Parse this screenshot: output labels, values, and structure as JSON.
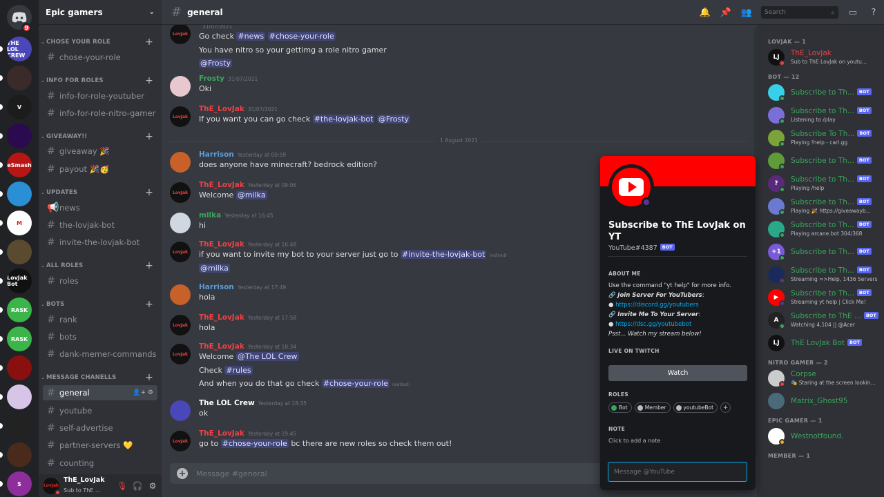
{
  "server": {
    "name": "Epic gamers",
    "home_badge": "9"
  },
  "rail": [
    {
      "label": "THE LOL CREW",
      "color": "#4a47b8"
    },
    {
      "label": "",
      "color": "#3b2a2a"
    },
    {
      "label": "V",
      "color": "#1c1c1c"
    },
    {
      "label": "",
      "color": "#2b0a4f"
    },
    {
      "label": "TheSmashen",
      "color": "#b81515"
    },
    {
      "label": "",
      "color": "#2a8fd4"
    },
    {
      "label": "M",
      "color": "#ffffff"
    },
    {
      "label": "",
      "color": "#5a4a30"
    },
    {
      "label": "LovJak Bot",
      "color": "#111111"
    },
    {
      "label": "RASK",
      "color": "#3bb54a"
    },
    {
      "label": "RASK",
      "color": "#3bb54a"
    },
    {
      "label": "",
      "color": "#8a1010"
    },
    {
      "label": "",
      "color": "#d7c5e8"
    },
    {
      "label": "",
      "color": "#222222"
    },
    {
      "label": "",
      "color": "#4a2a1a"
    },
    {
      "label": "S",
      "color": "#8e2d9c"
    }
  ],
  "categories": [
    {
      "name": "CHOSE YOUR ROLE",
      "channels": [
        "chose-your-role"
      ]
    },
    {
      "name": "INFO FOR ROLES",
      "channels": [
        "info-for-role-youtuber",
        "info-for-role-nitro-gamer"
      ]
    },
    {
      "name": "GIVEAWAY!!",
      "channels": [
        "giveaway 🎉",
        "payout 🎉🥳"
      ]
    },
    {
      "name": "UPDATES",
      "channels": [
        "news",
        "the-lovjak-bot",
        "invite-the-lovjak-bot"
      ]
    },
    {
      "name": "ALL ROLES",
      "channels": [
        "roles"
      ]
    },
    {
      "name": "BOTS",
      "channels": [
        "rank",
        "bots",
        "dank-memer-commands"
      ]
    },
    {
      "name": "MESSAGE CHANELLS",
      "channels": [
        "general",
        "youtube",
        "self-advertise",
        "partner-servers 💛",
        "counting"
      ]
    }
  ],
  "user": {
    "name": "ThE_LovJak",
    "status": "Sub to ThE ...",
    "avatar": "LovJak"
  },
  "channel": {
    "name": "general",
    "search_placeholder": "Search",
    "composer_placeholder": "Message #general"
  },
  "messages": [
    {
      "author": "",
      "time": "31/07/2021",
      "color": "#ed4245",
      "avatar": "LovJak",
      "avbg": "#111",
      "lines": [
        [
          "Go check ",
          {
            "m": "#news"
          },
          " ",
          {
            "m": "#chose-your-role"
          }
        ],
        [
          "You have nitro so your gettimg a role nitro gamer"
        ],
        [
          {
            "m": "@Frosty"
          }
        ]
      ],
      "partial": true
    },
    {
      "author": "Frosty",
      "time": "31/07/2021",
      "color": "#3ba55d",
      "avatar": "",
      "avbg": "#e8c8cf",
      "lines": [
        [
          "Oki"
        ]
      ]
    },
    {
      "author": "ThE_LovJak",
      "time": "31/07/2021",
      "color": "#ed4245",
      "avatar": "LovJak",
      "avbg": "#111",
      "lines": [
        [
          "If you want you can go check ",
          {
            "m": "#the-lovjak-bot"
          },
          " ",
          {
            "m": "@Frosty"
          }
        ]
      ]
    },
    {
      "author": "Harrison",
      "time": "Yesterday at 00:59",
      "color": "#5b9bd5",
      "avatar": "",
      "avbg": "#c8602a",
      "lines": [
        [
          "does anyone have minecraft? bedrock edition?"
        ]
      ]
    },
    {
      "author": "ThE_LovJak",
      "time": "Yesterday at 09:06",
      "color": "#ed4245",
      "avatar": "LovJak",
      "avbg": "#111",
      "lines": [
        [
          "Welcome ",
          {
            "m": "@milka"
          }
        ]
      ]
    },
    {
      "author": "milka",
      "time": "Yesterday at 16:45",
      "color": "#3ba55d",
      "avatar": "",
      "avbg": "#cfd8e0",
      "lines": [
        [
          "hi"
        ]
      ]
    },
    {
      "author": "ThE_LovJak",
      "time": "Yesterday at 16:48",
      "color": "#ed4245",
      "avatar": "LovJak",
      "avbg": "#111",
      "lines": [
        [
          "if you want to invite my bot to your server just go to ",
          {
            "m": "#invite-the-lovjak-bot"
          },
          {
            "e": "(edited)"
          }
        ],
        [
          {
            "m": "@milka"
          }
        ]
      ]
    },
    {
      "author": "Harrison",
      "time": "Yesterday at 17:49",
      "color": "#5b9bd5",
      "avatar": "",
      "avbg": "#c8602a",
      "lines": [
        [
          "hola"
        ]
      ]
    },
    {
      "author": "ThE_LovJak",
      "time": "Yesterday at 17:58",
      "color": "#ed4245",
      "avatar": "LovJak",
      "avbg": "#111",
      "lines": [
        [
          "hola"
        ]
      ]
    },
    {
      "author": "ThE_LovJak",
      "time": "Yesterday at 18:34",
      "color": "#ed4245",
      "avatar": "LovJak",
      "avbg": "#111",
      "lines": [
        [
          "Welcome ",
          {
            "m": "@The LOL Crew"
          }
        ],
        [
          "Check ",
          {
            "m": "#rules"
          }
        ],
        [
          "And when you do that go check ",
          {
            "m": "#chose-your-role"
          },
          {
            "e": "(edited)"
          }
        ]
      ]
    },
    {
      "author": "The LOL Crew",
      "time": "Yesterday at 18:35",
      "color": "#ffffff",
      "avatar": "",
      "avbg": "#4a47b8",
      "lines": [
        [
          "ok"
        ]
      ]
    },
    {
      "author": "ThE_LovJak",
      "time": "Yesterday at 19:45",
      "color": "#ed4245",
      "avatar": "LovJak",
      "avbg": "#111",
      "lines": [
        [
          "go to ",
          {
            "m": "#chose-your-role"
          },
          " bc there are new roles so check them out!"
        ]
      ]
    }
  ],
  "date_divider": "1 August 2021",
  "members": {
    "groups": [
      {
        "name": "LOVJAK — 1",
        "items": [
          {
            "name": "ThE_LovJak",
            "sub": "Sub to ThE LovJak on youtu...",
            "color": "#ed4245",
            "bot": false,
            "status": "#ed4245",
            "avbg": "#111",
            "av": "LJ"
          }
        ]
      },
      {
        "name": "BOT — 12",
        "items": [
          {
            "name": "Subscribe to Th...",
            "sub": "",
            "color": "#3ba55d",
            "bot": true,
            "status": "#3ba55d",
            "avbg": "#38d0e8",
            "av": ""
          },
          {
            "name": "Subscribe to Th...",
            "sub": "Listening to /play",
            "color": "#3ba55d",
            "bot": true,
            "status": "#3ba55d",
            "avbg": "#7a6fd8",
            "av": ""
          },
          {
            "name": "Subscribe To Th...",
            "sub": "Playing !help - carl.gg",
            "color": "#3ba55d",
            "bot": true,
            "status": "#3ba55d",
            "avbg": "#7aa33a",
            "av": ""
          },
          {
            "name": "Subscribe to Th...",
            "sub": "",
            "color": "#3ba55d",
            "bot": true,
            "status": "#3ba55d",
            "avbg": "#5e9c3a",
            "av": ""
          },
          {
            "name": "Subscribe to Th...",
            "sub": "Playing /help",
            "color": "#3ba55d",
            "bot": true,
            "status": "#3ba55d",
            "avbg": "#5a2a7a",
            "av": "?"
          },
          {
            "name": "Subscribe to Th...",
            "sub": "Playing 🎉 https://giveawayb...",
            "color": "#3ba55d",
            "bot": true,
            "status": "#3ba55d",
            "avbg": "#6a7ad0",
            "av": ""
          },
          {
            "name": "Subscribe to Th...",
            "sub": "Playing arcane.bot 304/368",
            "color": "#3ba55d",
            "bot": true,
            "status": "#3ba55d",
            "avbg": "#2aa88a",
            "av": ""
          },
          {
            "name": "Subscribe to Th...",
            "sub": "",
            "color": "#3ba55d",
            "bot": true,
            "status": "#3ba55d",
            "avbg": "#7a5ad8",
            "av": "+1"
          },
          {
            "name": "Subscribe to Th...",
            "sub": "Streaming =>Help, 1436 Servers",
            "color": "#3ba55d",
            "bot": true,
            "status": "#593695",
            "avbg": "#1a2a5a",
            "av": ""
          },
          {
            "name": "Subscribe to Th...",
            "sub": "Streaming yt help | Click Me!",
            "color": "#3ba55d",
            "bot": true,
            "status": "#593695",
            "avbg": "#ff0000",
            "av": "▶"
          },
          {
            "name": "Subscribe to ThE ...",
            "sub": "Watching 4,104 || @Acer",
            "color": "#3ba55d",
            "bot": true,
            "status": "#3ba55d",
            "avbg": "#222",
            "av": "A"
          },
          {
            "name": "ThE LovJak Bot",
            "sub": "",
            "color": "#3ba55d",
            "bot": true,
            "status": "",
            "avbg": "#111",
            "av": "LJ"
          }
        ]
      },
      {
        "name": "NITRO GAMER — 2",
        "items": [
          {
            "name": "Corpse",
            "sub": "🎭 Staring at the screen lookin...",
            "color": "#3ba55d",
            "bot": false,
            "status": "#ed4245",
            "avbg": "#ccc",
            "av": ""
          },
          {
            "name": "Matrix_Ghost95",
            "sub": "",
            "color": "#3ba55d",
            "bot": false,
            "status": "",
            "avbg": "#4a6a7a",
            "av": ""
          }
        ]
      },
      {
        "name": "EPIC GAMER — 1",
        "items": [
          {
            "name": "Westnotfound.",
            "sub": "",
            "color": "#3ba55d",
            "bot": false,
            "status": "#faa61a",
            "avbg": "#fff",
            "av": ""
          }
        ]
      },
      {
        "name": "MEMBER — 1",
        "items": []
      }
    ]
  },
  "profile": {
    "name": "Subscribe to ThE LovJak on YT",
    "tag": "YouTube#4387",
    "bot_label": "BOT",
    "about_title": "ABOUT ME",
    "about_line1": "Use the command \"yt help\" for more info.",
    "join_label": "Join Server For YouTubers",
    "join_link": "https://discord.gg/youtubers",
    "invite_label": "Invite Me To Your Server",
    "invite_link": "https://dsc.gg/youtubebot",
    "psst": "Psst... Watch my stream below!",
    "twitch_title": "LIVE ON TWITCH",
    "watch_label": "Watch",
    "roles_title": "ROLES",
    "roles": [
      {
        "name": "Bot",
        "color": "#3ba55d"
      },
      {
        "name": "Member",
        "color": "#b9bbbe"
      },
      {
        "name": "youtubeBot",
        "color": "#b9bbbe"
      }
    ],
    "note_title": "NOTE",
    "note_placeholder": "Click to add a note",
    "dm_placeholder": "Message @YouTube"
  }
}
